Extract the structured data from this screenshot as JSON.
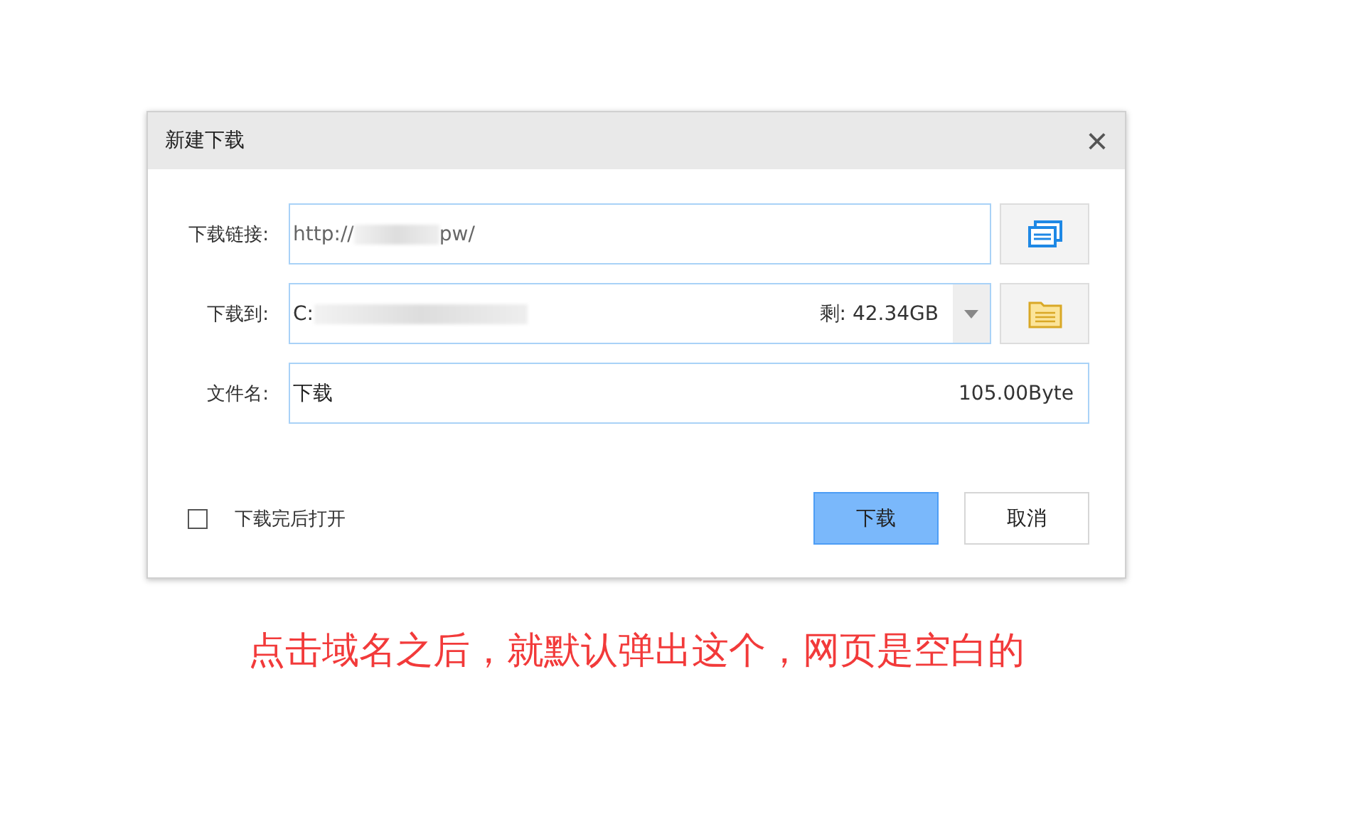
{
  "dialog": {
    "title": "新建下载",
    "close": "×"
  },
  "url_row": {
    "label": "下载链接:",
    "value_start": "http://",
    "value_end": "pw/"
  },
  "path_row": {
    "label": "下载到:",
    "value_start": "C:",
    "free_label": "剩:",
    "free": "42.34GB"
  },
  "name_row": {
    "label": "文件名:",
    "value": "下载",
    "size": "105.00Byte"
  },
  "open_after": {
    "label": "下载完后打开",
    "checked": false
  },
  "buttons": [
    {
      "label": "下载",
      "primary": true
    },
    {
      "label": "取消",
      "primary": false
    }
  ],
  "caption": "点击域名之后，就默认弹出这个，网页是空白的"
}
